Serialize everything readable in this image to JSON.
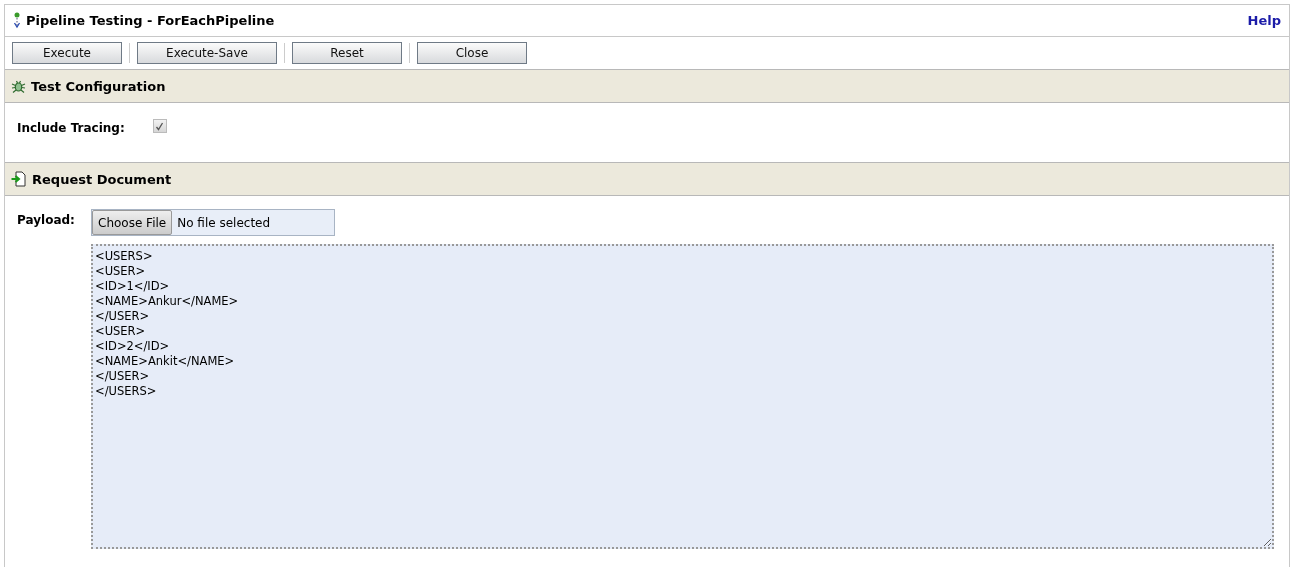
{
  "window": {
    "title": "Pipeline Testing - ForEachPipeline",
    "help_link": "Help"
  },
  "toolbar": {
    "buttons": [
      "Execute",
      "Execute-Save",
      "Reset",
      "Close"
    ]
  },
  "test_configuration": {
    "title": "Test Configuration",
    "include_tracing": {
      "label": "Include Tracing:",
      "checked": true
    }
  },
  "request_document": {
    "title": "Request Document",
    "payload": {
      "label": "Payload:",
      "choose_button": "Choose File",
      "file_status": "No file selected",
      "content": [
        "<USERS>",
        "<USER>",
        "<ID>1</ID>",
        "<NAME>Ankur</NAME>",
        "</USER>",
        "<USER>",
        "<ID>2</ID>",
        "<NAME>Ankit</NAME>",
        "</USER>",
        "</USERS>"
      ]
    }
  }
}
